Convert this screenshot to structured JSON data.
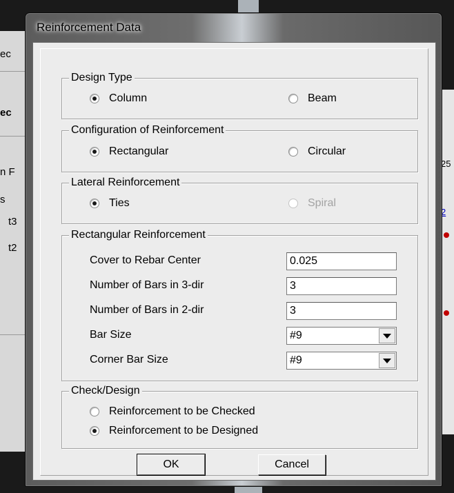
{
  "background": {
    "left_fragments": [
      "ec",
      "ec",
      "n F",
      "s",
      "t3",
      "t2"
    ],
    "right_fragments": [
      "25",
      "2"
    ]
  },
  "dialog": {
    "title": "Reinforcement Data",
    "design_type": {
      "legend": "Design Type",
      "options": [
        {
          "label": "Column",
          "checked": true
        },
        {
          "label": "Beam",
          "checked": false
        }
      ]
    },
    "configuration": {
      "legend": "Configuration of Reinforcement",
      "options": [
        {
          "label": "Rectangular",
          "checked": true
        },
        {
          "label": "Circular",
          "checked": false
        }
      ]
    },
    "lateral": {
      "legend": "Lateral Reinforcement",
      "options": [
        {
          "label": "Ties",
          "checked": true
        },
        {
          "label": "Spiral",
          "checked": false,
          "disabled": true
        }
      ]
    },
    "rectangular": {
      "legend": "Rectangular Reinforcement",
      "fields": [
        {
          "label": "Cover to Rebar Center",
          "value": "0.025",
          "kind": "text"
        },
        {
          "label": "Number of Bars in 3-dir",
          "value": "3",
          "kind": "text"
        },
        {
          "label": "Number of Bars in 2-dir",
          "value": "3",
          "kind": "text"
        },
        {
          "label": "Bar Size",
          "value": "#9",
          "kind": "select"
        },
        {
          "label": "Corner Bar Size",
          "value": "#9",
          "kind": "select"
        }
      ]
    },
    "check_design": {
      "legend": "Check/Design",
      "options": [
        {
          "label": "Reinforcement to be Checked",
          "checked": false
        },
        {
          "label": "Reinforcement to be Designed",
          "checked": true
        }
      ]
    },
    "buttons": {
      "ok": "OK",
      "cancel": "Cancel"
    }
  }
}
